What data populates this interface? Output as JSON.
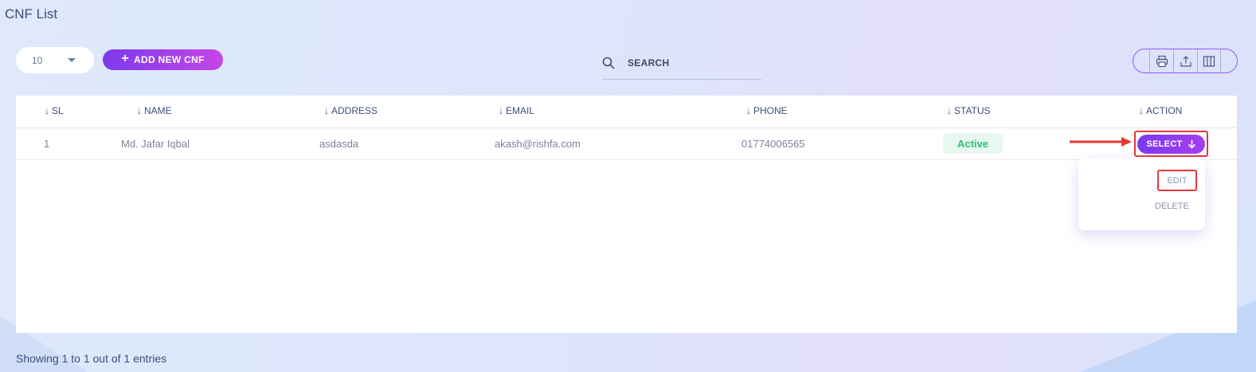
{
  "page": {
    "title": "CNF List"
  },
  "toolbar": {
    "page_size_value": "10",
    "add_button_label": "ADD NEW CNF",
    "search_placeholder": "SEARCH",
    "icons": [
      "print-icon",
      "export-icon",
      "columns-icon"
    ]
  },
  "table": {
    "columns": [
      "SL",
      "NAME",
      "ADDRESS",
      "EMAIL",
      "PHONE",
      "STATUS",
      "ACTION"
    ],
    "rows": [
      {
        "sl": "1",
        "name": "Md. Jafar Iqbal",
        "address": "asdasda",
        "email": "akash@rishfa.com",
        "phone": "01774006565",
        "status": "Active",
        "action_label": "SELECT"
      }
    ]
  },
  "action_menu": {
    "items": [
      "EDIT",
      "DELETE"
    ]
  },
  "footer": {
    "info": "Showing 1 to 1 out of 1 entries"
  },
  "colors": {
    "accent": "#7c3aed",
    "accent_gradient_end": "#c545e8",
    "status_active": "#28c27a",
    "highlight_red": "#e53935"
  }
}
